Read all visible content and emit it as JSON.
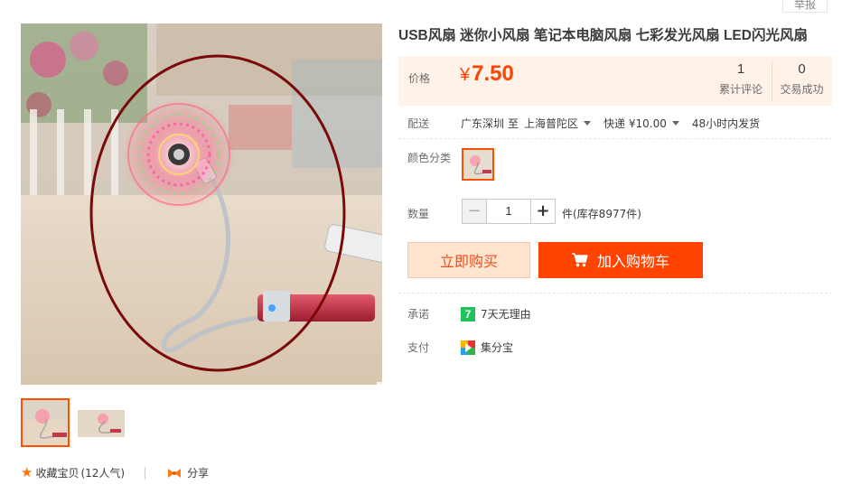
{
  "report_label": "举报",
  "title": "USB风扇 迷你小风扇 笔记本电脑风扇 七彩发光风扇 LED闪光风扇",
  "price": {
    "label": "价格",
    "currency": "¥",
    "amount": "7.50",
    "color": "#ff4400"
  },
  "stats": [
    {
      "value": "1",
      "label": "累计评论"
    },
    {
      "value": "0",
      "label": "交易成功"
    }
  ],
  "shipping": {
    "label": "配送",
    "from": "广东深圳",
    "to_word": "至",
    "destination": "上海普陀区",
    "method": "快递 ¥10.00",
    "dispatch": "48小时内发货"
  },
  "color_option": {
    "label": "颜色分类"
  },
  "quantity": {
    "label": "数量",
    "value": "1",
    "minus": "−",
    "plus": "+",
    "stock_text": "件(库存8977件)"
  },
  "buttons": {
    "buy_now": "立即购买",
    "add_cart": "加入购物车"
  },
  "promise": {
    "label": "承诺",
    "icon_text": "7",
    "text": "7天无理由"
  },
  "payment": {
    "label": "支付",
    "text": "集分宝"
  },
  "footer": {
    "favorite": "收藏宝贝",
    "popularity": "(12人气)",
    "share": "分享"
  },
  "accent_color": "#ff5000"
}
